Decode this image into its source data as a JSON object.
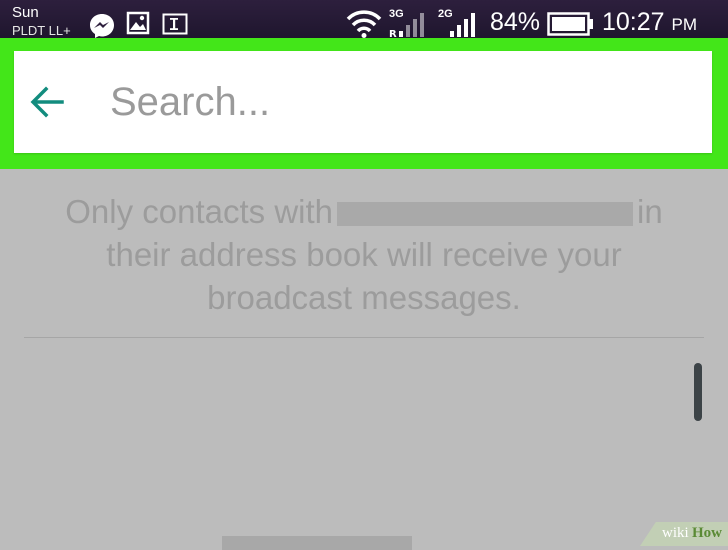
{
  "status_bar": {
    "carrier": "Sun",
    "carrier_sub": "PLDT LL+",
    "network_3g": "3G",
    "network_2g": "2G",
    "battery_percent": "84%",
    "time": "10:27",
    "am_pm": "PM",
    "icons": [
      "messenger-icon",
      "gallery-icon",
      "text-icon",
      "wifi-icon",
      "signal-icon",
      "battery-icon"
    ]
  },
  "search": {
    "placeholder": "Search...",
    "value": ""
  },
  "overlay": {
    "line1_start": "Only contacts with",
    "line1_end": "in",
    "line2": "their address book will receive your",
    "line3": "broadcast messages."
  },
  "watermark": {
    "wiki": "wiki",
    "how": "How"
  },
  "colors": {
    "highlight": "#43e619",
    "accent": "#128c7e",
    "overlay_bg": "#bcbcbc",
    "status_bar": "#241a33"
  }
}
